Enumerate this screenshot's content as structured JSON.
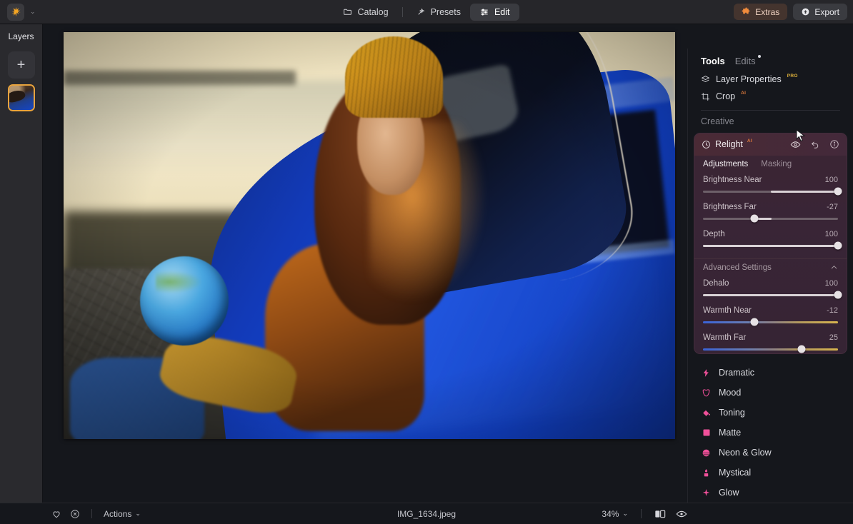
{
  "app": {
    "logo_icon": "sunburst-icon",
    "logo_caret": "⌄"
  },
  "topbar": {
    "tabs": [
      {
        "label": "Catalog",
        "icon": "folder-icon",
        "active": false
      },
      {
        "label": "Presets",
        "icon": "wand-icon",
        "active": false
      },
      {
        "label": "Edit",
        "icon": "sliders-icon",
        "active": true
      }
    ],
    "extras_label": "Extras",
    "extras_icon": "puzzle-icon",
    "export_label": "Export",
    "export_icon": "upload-circle-icon"
  },
  "layers": {
    "title": "Layers",
    "add_label": "+",
    "thumbnail_name": "layer-thumbnail"
  },
  "right_panel": {
    "tabs": [
      {
        "label": "Tools",
        "active": true,
        "dot": false
      },
      {
        "label": "Edits",
        "active": false,
        "dot": true
      }
    ],
    "tools": [
      {
        "label": "Layer Properties",
        "badge": "PRO",
        "badge_type": "pro",
        "icon": "layers-icon"
      },
      {
        "label": "Crop",
        "badge": "AI",
        "badge_type": "ai",
        "icon": "crop-icon"
      }
    ],
    "section_label": "Creative",
    "relight": {
      "title": "Relight",
      "badge": "AI",
      "icon": "relight-icon",
      "head_icons": [
        "eye-icon",
        "undo-icon",
        "info-icon"
      ],
      "subtabs": [
        {
          "label": "Adjustments",
          "active": true
        },
        {
          "label": "Masking",
          "active": false
        }
      ],
      "sliders": [
        {
          "name": "Brightness Near",
          "value": "100",
          "percent": 100,
          "fill_from": 50,
          "kind": "plain"
        },
        {
          "name": "Brightness Far",
          "value": "-27",
          "percent": 37,
          "fill_from": 37,
          "fill_to": 50,
          "kind": "plain"
        },
        {
          "name": "Depth",
          "value": "100",
          "percent": 100,
          "fill_from": 0,
          "kind": "plain"
        }
      ],
      "advanced": {
        "title": "Advanced Settings",
        "chevron": "⌃",
        "sliders": [
          {
            "name": "Dehalo",
            "value": "100",
            "percent": 100,
            "fill_from": 0,
            "kind": "plain"
          },
          {
            "name": "Warmth Near",
            "value": "-12",
            "percent": 38,
            "kind": "warm"
          },
          {
            "name": "Warmth Far",
            "value": "25",
            "percent": 73,
            "kind": "warm"
          }
        ]
      }
    },
    "presets": [
      {
        "label": "Dramatic",
        "icon": "lightning-icon"
      },
      {
        "label": "Mood",
        "icon": "mask-icon"
      },
      {
        "label": "Toning",
        "icon": "paint-bucket-icon"
      },
      {
        "label": "Matte",
        "icon": "square-icon"
      },
      {
        "label": "Neon & Glow",
        "icon": "sphere-icon"
      },
      {
        "label": "Mystical",
        "icon": "candle-icon"
      },
      {
        "label": "Glow",
        "icon": "sparkle-icon"
      }
    ]
  },
  "bottombar": {
    "favorite_icon": "heart-icon",
    "reject_icon": "circle-x-icon",
    "actions_label": "Actions",
    "actions_caret": "⌄",
    "filename": "IMG_1634.jpeg",
    "zoom_label": "34%",
    "zoom_caret": "⌄",
    "compare_icon": "before-after-icon",
    "preview_icon": "eye-icon"
  },
  "colors": {
    "accent_orange": "#e8a33d",
    "accent_pink": "#f0509a",
    "pro_gold": "#e0b33c",
    "ai_orange": "#e07b3c",
    "panel_bg": "#15171c",
    "relight_bg": "#3b2533"
  }
}
